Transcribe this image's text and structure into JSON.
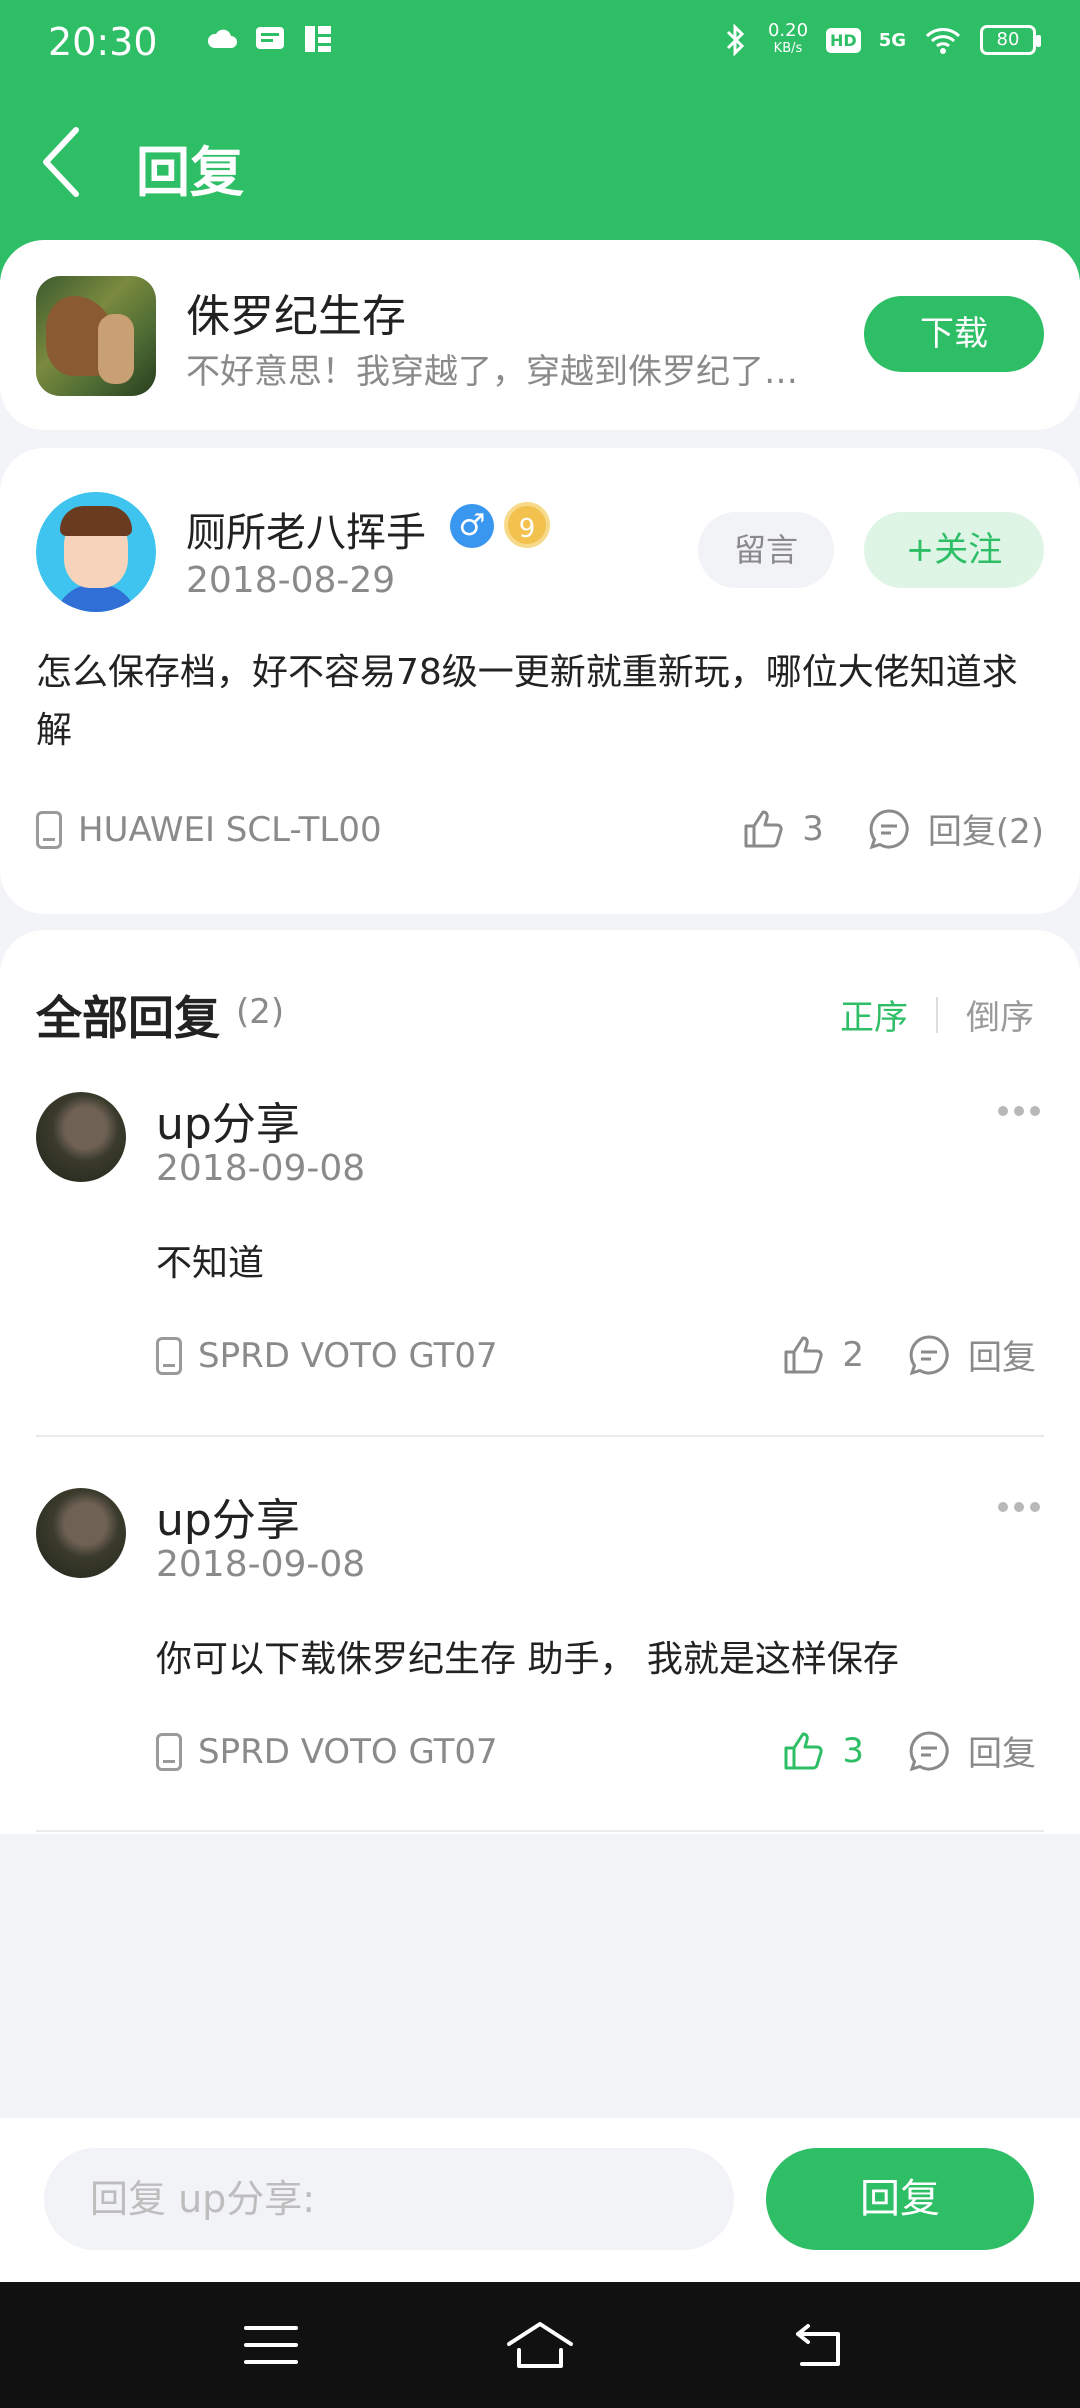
{
  "status": {
    "time": "20:30",
    "speed": "0.20",
    "speed_unit": "KB/s",
    "hd": "HD",
    "network": "5G",
    "battery": "80"
  },
  "header": {
    "title": "回复"
  },
  "app": {
    "name": "侏罗纪生存",
    "subtitle": "不好意思！我穿越了，穿越到侏罗纪了…",
    "download_label": "下载"
  },
  "post": {
    "author": "厕所老八挥手",
    "gender_symbol": "♂",
    "level": "9",
    "date": "2018-08-29",
    "message_label": "留言",
    "follow_label": "+关注",
    "content": "怎么保存档，好不容易78级一更新就重新玩，哪位大佬知道求解",
    "device": "HUAWEI SCL-TL00",
    "likes": "3",
    "reply_label": "回复(2)"
  },
  "replies_section": {
    "title": "全部回复",
    "count": "(2)",
    "sort_asc": "正序",
    "sort_desc": "倒序"
  },
  "replies": [
    {
      "author": "up分享",
      "date": "2018-09-08",
      "content": "不知道",
      "device": "SPRD VOTO GT07",
      "likes": "2",
      "liked": false,
      "reply_label": "回复"
    },
    {
      "author": "up分享",
      "date": "2018-09-08",
      "content": "你可以下载侏罗纪生存 助手， 我就是这样保存",
      "device": "SPRD VOTO GT07",
      "likes": "3",
      "liked": true,
      "reply_label": "回复"
    }
  ],
  "input": {
    "placeholder": "回复 up分享:",
    "submit_label": "回复"
  },
  "colors": {
    "brand": "#2dbe66",
    "muted": "#8a8a8a"
  }
}
